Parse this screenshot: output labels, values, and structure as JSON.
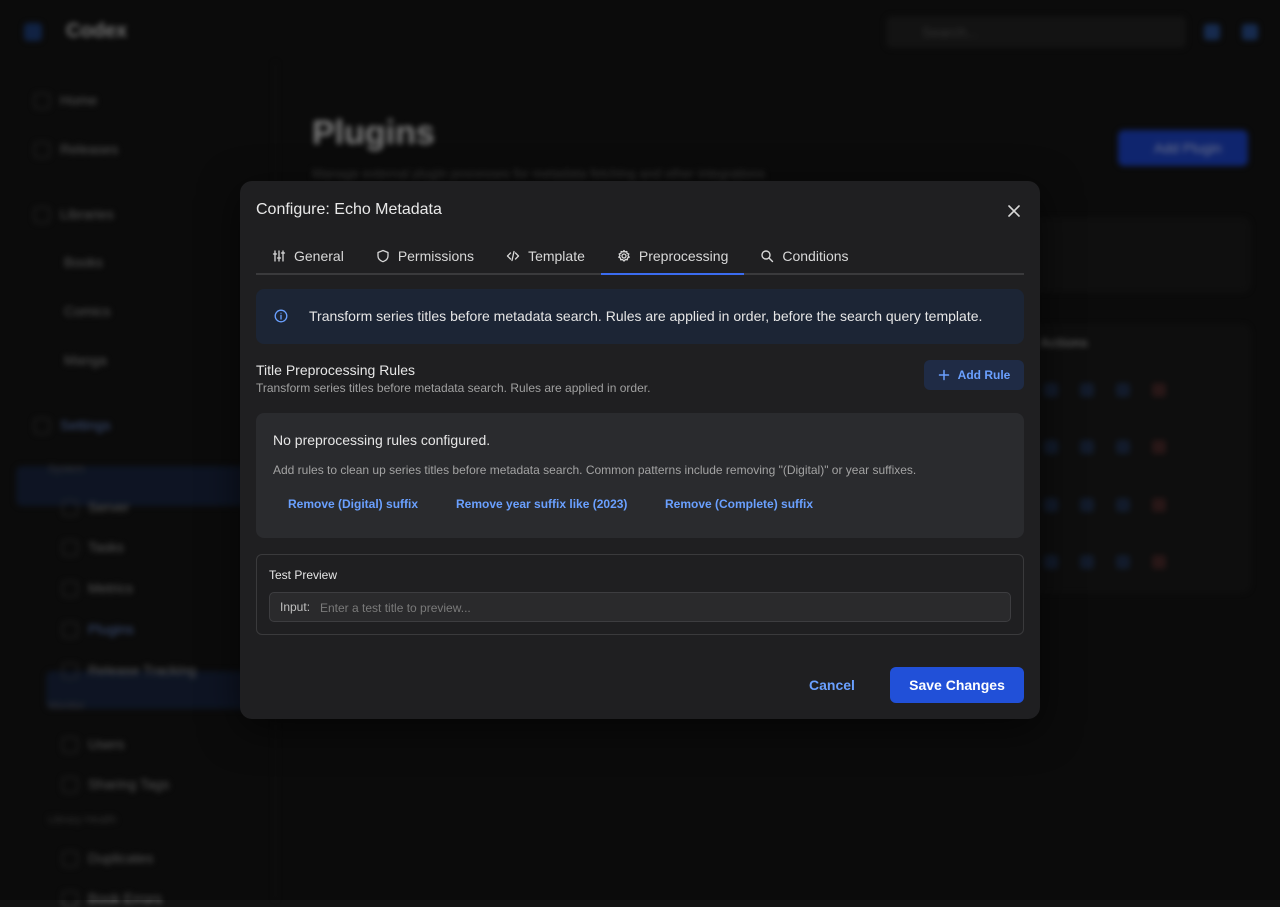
{
  "background": {
    "app_name": "Codex",
    "search_placeholder": "Search...",
    "nav": [
      "Home",
      "Releases",
      "Libraries",
      "Books",
      "Comics",
      "Manga",
      "Settings"
    ],
    "sections": [
      "System",
      "Server",
      "Tasks",
      "Metrics",
      "Plugins",
      "Release Tracking",
      "Monitor",
      "Users",
      "Sharing Tags",
      "Library Health",
      "Duplicates",
      "Book Errors"
    ],
    "page_title": "Plugins",
    "page_subtitle": "Manage external plugin processes for metadata fetching and other integrations",
    "add_plugin_label": "Add Plugin",
    "actions_header": "Actions"
  },
  "modal": {
    "title": "Configure: Echo Metadata",
    "tabs": [
      {
        "label": "General",
        "icon": "sliders-icon"
      },
      {
        "label": "Permissions",
        "icon": "shield-icon"
      },
      {
        "label": "Template",
        "icon": "code-icon"
      },
      {
        "label": "Preprocessing",
        "icon": "gear-icon"
      },
      {
        "label": "Conditions",
        "icon": "search-icon"
      }
    ],
    "active_tab": "Preprocessing",
    "info_text": "Transform series titles before metadata search. Rules are applied in order, before the search query template.",
    "rules_title": "Title Preprocessing Rules",
    "rules_subtitle": "Transform series titles before metadata search. Rules are applied in order.",
    "add_rule_label": "Add Rule",
    "empty_title": "No preprocessing rules configured.",
    "empty_description": "Add rules to clean up series titles before metadata search. Common patterns include removing \"(Digital)\" or year suffixes.",
    "suggestions": [
      "Remove (Digital) suffix",
      "Remove year suffix like (2023)",
      "Remove (Complete) suffix"
    ],
    "preview_title": "Test Preview",
    "preview_input_label": "Input:",
    "preview_input_placeholder": "Enter a test title to preview...",
    "preview_input_value": "",
    "cancel_label": "Cancel",
    "save_label": "Save Changes"
  },
  "colors": {
    "accent": "#2150d8",
    "link": "#6aa0ff",
    "modal_bg": "#1f1f21",
    "info_bg": "#1c2535"
  }
}
